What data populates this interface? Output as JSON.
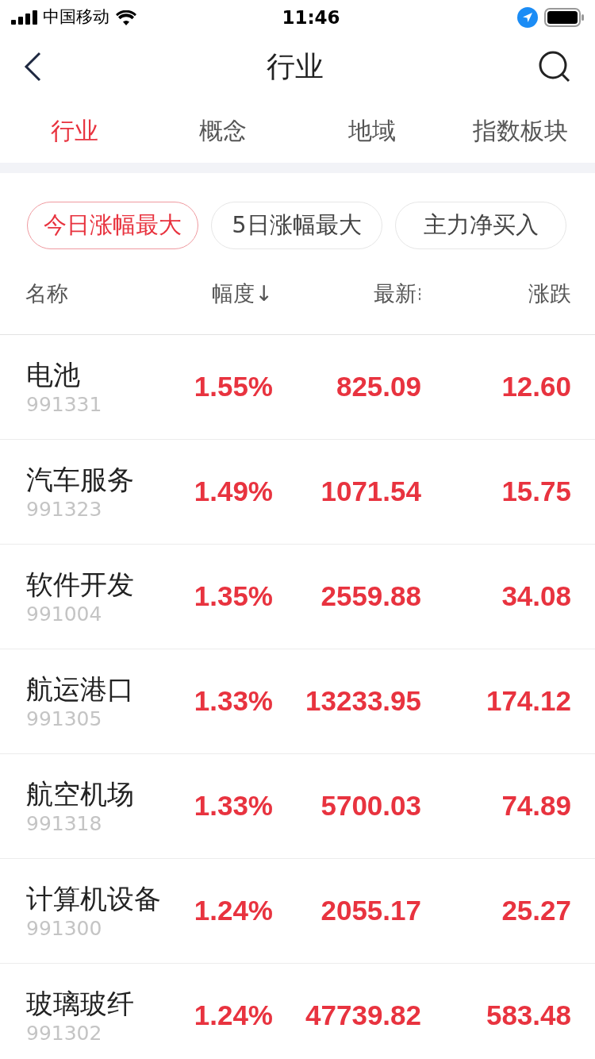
{
  "status_bar": {
    "carrier": "中国移动",
    "time": "11:46"
  },
  "nav": {
    "title": "行业"
  },
  "tabs": [
    {
      "label": "行业",
      "selected": true
    },
    {
      "label": "概念",
      "selected": false
    },
    {
      "label": "地域",
      "selected": false
    },
    {
      "label": "指数板块",
      "selected": false
    }
  ],
  "filters": [
    {
      "label": "今日涨幅最大",
      "selected": true
    },
    {
      "label": "5日涨幅最大",
      "selected": false
    },
    {
      "label": "主力净买入",
      "selected": false
    }
  ],
  "table": {
    "columns": [
      {
        "label": "名称",
        "kind": "plain"
      },
      {
        "label": "幅度↓",
        "kind": "plain"
      },
      {
        "label": "最新",
        "kind": "sortable"
      },
      {
        "label": "涨跌",
        "kind": "plain"
      }
    ],
    "rows": [
      {
        "name": "电池",
        "code": "991331",
        "change_pct": "1.55%",
        "latest": "825.09",
        "change": "12.60"
      },
      {
        "name": "汽车服务",
        "code": "991323",
        "change_pct": "1.49%",
        "latest": "1071.54",
        "change": "15.75"
      },
      {
        "name": "软件开发",
        "code": "991004",
        "change_pct": "1.35%",
        "latest": "2559.88",
        "change": "34.08"
      },
      {
        "name": "航运港口",
        "code": "991305",
        "change_pct": "1.33%",
        "latest": "13233.95",
        "change": "174.12"
      },
      {
        "name": "航空机场",
        "code": "991318",
        "change_pct": "1.33%",
        "latest": "5700.03",
        "change": "74.89"
      },
      {
        "name": "计算机设备",
        "code": "991300",
        "change_pct": "1.24%",
        "latest": "2055.17",
        "change": "25.27"
      },
      {
        "name": "玻璃玻纤",
        "code": "991302",
        "change_pct": "1.24%",
        "latest": "47739.82",
        "change": "583.48"
      }
    ]
  }
}
